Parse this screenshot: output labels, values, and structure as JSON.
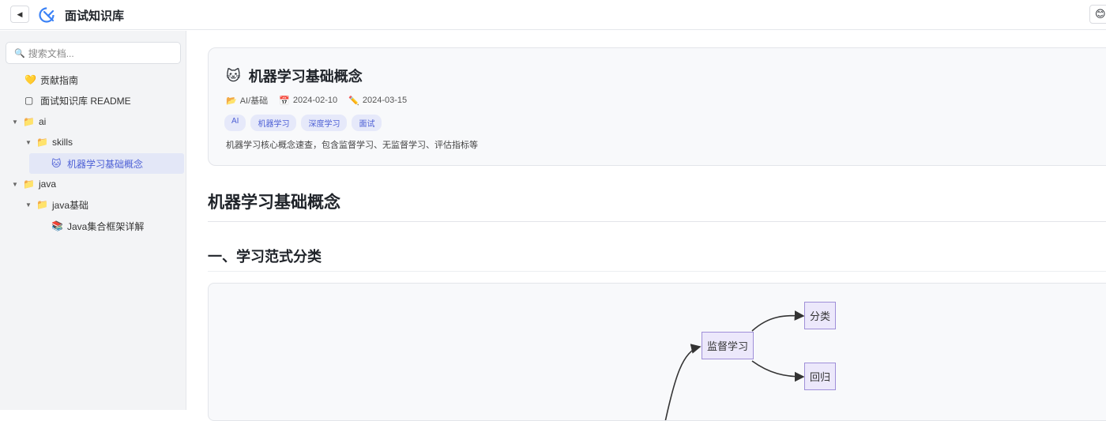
{
  "header": {
    "back_icon": "◀",
    "app_title": "面试知识库",
    "theme_icon": "😊"
  },
  "sidebar": {
    "search_placeholder": "搜索文档...",
    "items": [
      {
        "label": "贡献指南",
        "icon": "💛"
      },
      {
        "label": "面试知识库 README",
        "icon": "▢"
      },
      {
        "label": "ai",
        "icon": "📁"
      },
      {
        "label": "skills",
        "icon": "📁"
      },
      {
        "label": "机器学习基础概念",
        "icon": "🐱",
        "active": true
      },
      {
        "label": "java",
        "icon": "📁"
      },
      {
        "label": "java基础",
        "icon": "📁"
      },
      {
        "label": "Java集合框架详解",
        "icon": "📚"
      }
    ]
  },
  "doc": {
    "emoji": "🐱",
    "title": "机器学习基础概念",
    "category": "AI/基础",
    "created": "2024-02-10",
    "updated": "2024-03-15",
    "tags": [
      "AI",
      "机器学习",
      "深度学习",
      "面试"
    ],
    "summary": "机器学习核心概念速查，包含监督学习、无监督学习、评估指标等"
  },
  "content": {
    "h1": "机器学习基础概念",
    "h2": "一、学习范式分类"
  },
  "diagram": {
    "nodes": {
      "supervised": "监督学习",
      "classification": "分类",
      "regression": "回归"
    },
    "node_color": "#ece8fb",
    "border_color": "#9f8fd8"
  },
  "colors": {
    "accent": "#4c5fd5",
    "sidebar_bg": "#f3f4f6",
    "active_bg": "#e3e7f7"
  }
}
